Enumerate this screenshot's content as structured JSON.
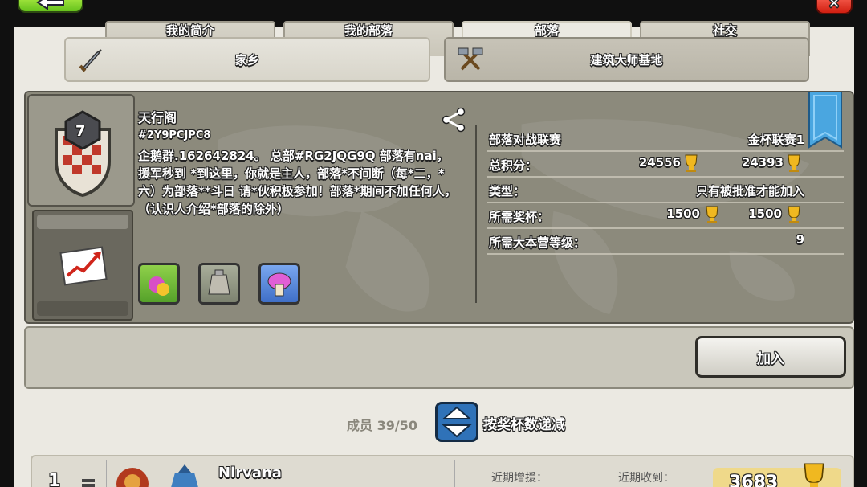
{
  "tabs": [
    {
      "label": "我的简介",
      "active": false
    },
    {
      "label": "我的部落",
      "active": false
    },
    {
      "label": "部落",
      "active": true
    },
    {
      "label": "社交",
      "active": false
    }
  ],
  "village_buttons": {
    "home": "家乡",
    "builder": "建筑大师基地"
  },
  "clan": {
    "level": "7",
    "name": "天行阁",
    "tag": "#2Y9PCJPC8",
    "description": "企鹅群.162642824。      总部#RG2JQG9Q 部落有nai，援军秒到  *到这里，你就是主人，部落*不间断（每*二，*六）为部落**斗日 请*伙积极参加！部落*期间不加任何人，（认识人介绍*部落的除外）"
  },
  "info": {
    "war_league_label": "部落对战联赛",
    "war_league_value": "金杯联赛1",
    "points_label": "总积分：",
    "points_home": "24556",
    "points_builder": "24393",
    "type_label": "类型：",
    "type_value": "只有被批准才能加入",
    "req_trophies_label": "所需奖杯：",
    "req_trophies_home": "1500",
    "req_trophies_builder": "1500",
    "req_th_label": "所需大本营等级：",
    "req_th_value": "9"
  },
  "join_label": "加入",
  "members": {
    "count_text": "成员 39/50",
    "sort_label": "按奖杯数递减"
  },
  "member_row": {
    "rank": "1",
    "name": "Nirvana",
    "recent_donated_label": "近期增援：",
    "recent_received_label": "近期收到：",
    "trophies": "3683"
  },
  "colors": {
    "accent_green": "#66c21c",
    "close_red": "#d01e10",
    "sort_blue": "#2f72b8",
    "trophy_gold": "#f0b820"
  }
}
